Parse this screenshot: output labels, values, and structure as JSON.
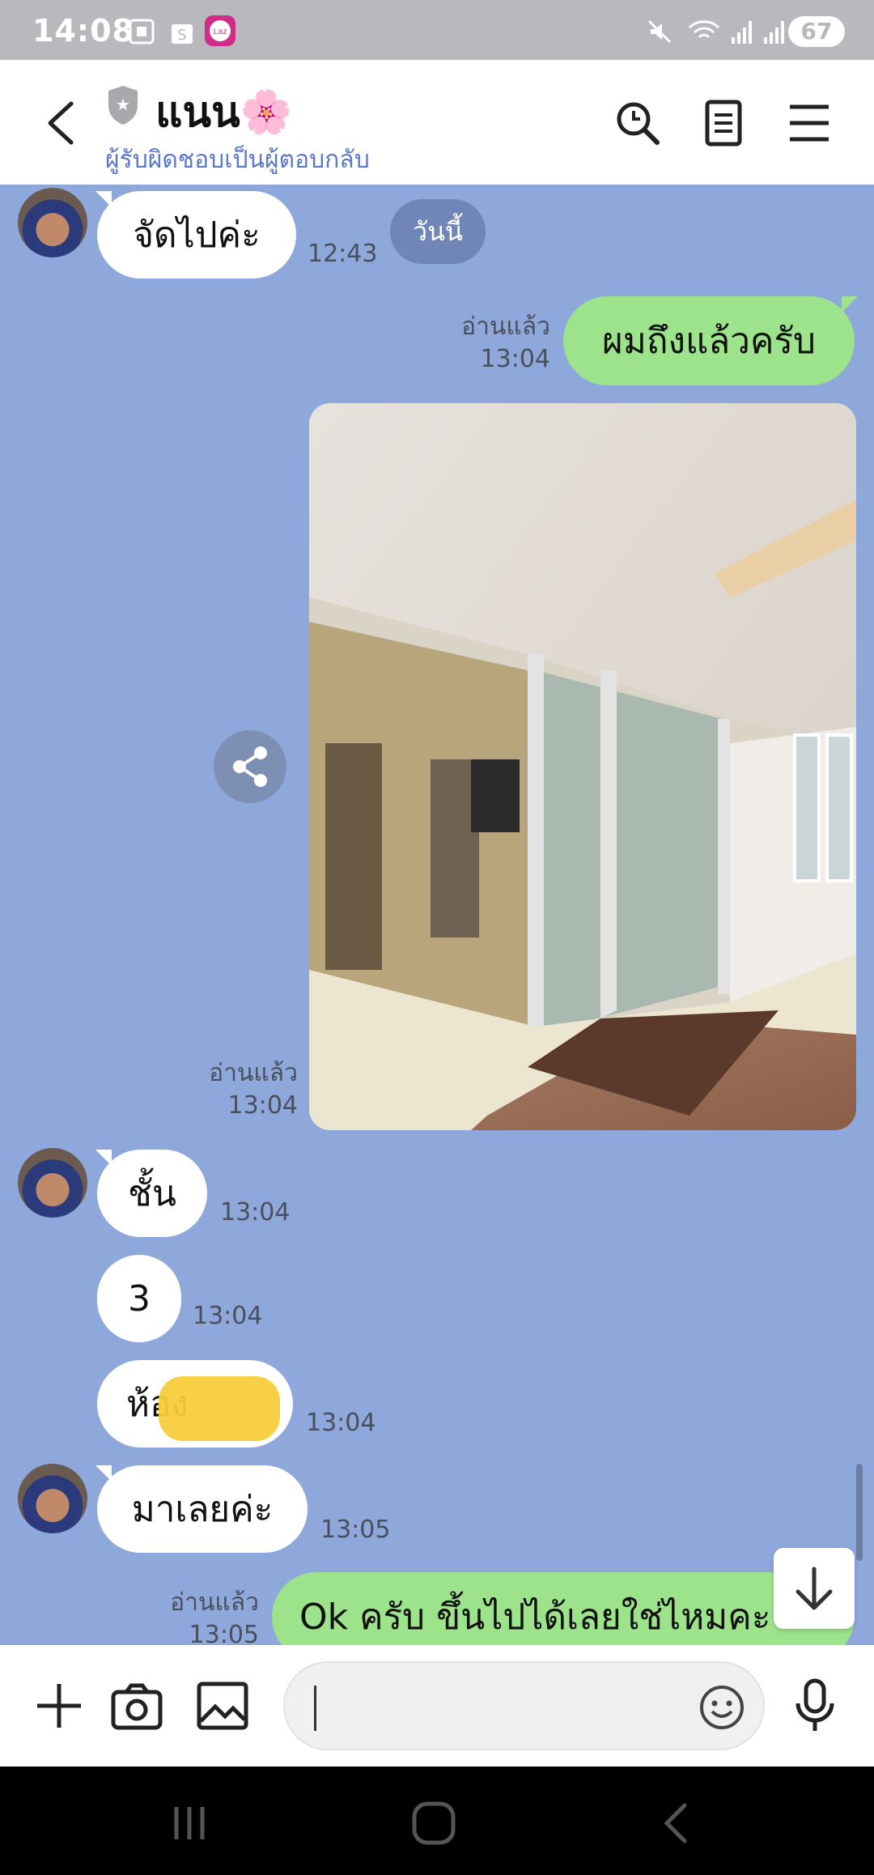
{
  "status_bar": {
    "time": "14:08",
    "battery": "67"
  },
  "header": {
    "title": "แนน🌸",
    "subtitle": "ผู้รับผิดชอบเป็นผู้ตอบกลับ"
  },
  "chat": {
    "date_chip": "วันนี้",
    "read_label": "อ่านแล้ว",
    "messages": [
      {
        "side": "in",
        "text": "จัดไปค่ะ",
        "time": "12:43"
      },
      {
        "side": "out",
        "text": "ผมถึงแล้วครับ",
        "time": "13:04"
      },
      {
        "side": "out",
        "type": "image",
        "time": "13:04"
      },
      {
        "side": "in",
        "text": "ชั้น",
        "time": "13:04"
      },
      {
        "side": "in",
        "text": "3",
        "time": "13:04"
      },
      {
        "side": "in",
        "text": "ห้อง",
        "time": "13:04"
      },
      {
        "side": "in",
        "text": "มาเลยค่ะ",
        "time": "13:05"
      },
      {
        "side": "out",
        "text": "Ok ครับ ขึ้นไปได้เลยใช่ไหมคะ",
        "time": "13:05"
      }
    ]
  },
  "input": {
    "placeholder": ""
  },
  "colors": {
    "chat_bg": "#8fa8dc",
    "bubble_out": "#9de38b",
    "bubble_in": "#ffffff",
    "accent": "#5a78c9"
  }
}
